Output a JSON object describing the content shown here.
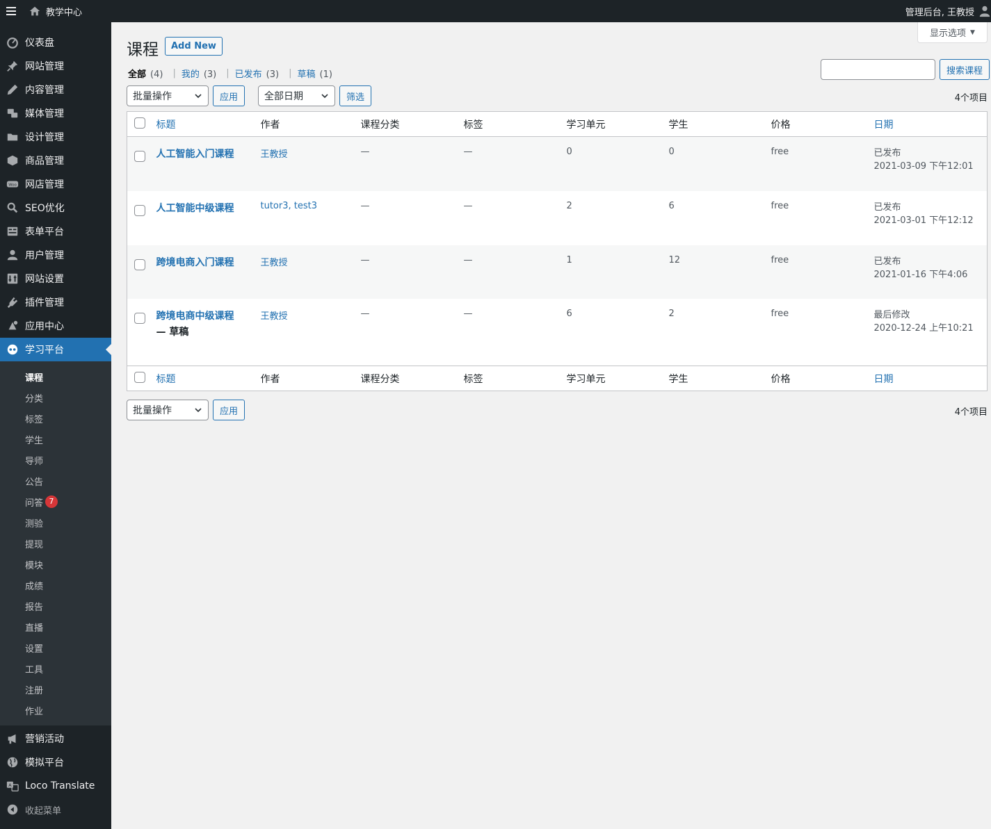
{
  "adminbar": {
    "site_name": "教学中心",
    "account_text": "管理后台, 王教授"
  },
  "sidebar": {
    "items": [
      {
        "label": "仪表盘",
        "icon": "dashboard-icon"
      },
      {
        "label": "网站管理",
        "icon": "pin-icon"
      },
      {
        "label": "内容管理",
        "icon": "pencil-icon"
      },
      {
        "label": "媒体管理",
        "icon": "media-icon"
      },
      {
        "label": "设计管理",
        "icon": "folder-icon"
      },
      {
        "label": "商品管理",
        "icon": "box-icon"
      },
      {
        "label": "网店管理",
        "icon": "woo-icon"
      },
      {
        "label": "SEO优化",
        "icon": "search-icon"
      },
      {
        "label": "表单平台",
        "icon": "form-icon"
      },
      {
        "label": "用户管理",
        "icon": "user-icon"
      },
      {
        "label": "网站设置",
        "icon": "settings-icon"
      },
      {
        "label": "插件管理",
        "icon": "plugin-icon"
      },
      {
        "label": "应用中心",
        "icon": "apps-icon"
      },
      {
        "label": "学习平台",
        "icon": "tutor-icon"
      }
    ],
    "submenu": [
      {
        "label": "课程"
      },
      {
        "label": "分类"
      },
      {
        "label": "标签"
      },
      {
        "label": "学生"
      },
      {
        "label": "导师"
      },
      {
        "label": "公告"
      },
      {
        "label": "问答",
        "badge": "7"
      },
      {
        "label": "测验"
      },
      {
        "label": "提现"
      },
      {
        "label": "模块"
      },
      {
        "label": "成绩"
      },
      {
        "label": "报告"
      },
      {
        "label": "直播"
      },
      {
        "label": "设置"
      },
      {
        "label": "工具"
      },
      {
        "label": "注册"
      },
      {
        "label": "作业"
      }
    ],
    "after_items": [
      {
        "label": "营销活动",
        "icon": "megaphone-icon"
      },
      {
        "label": "模拟平台",
        "icon": "globe-icon"
      },
      {
        "label": "Loco Translate",
        "icon": "translate-icon"
      },
      {
        "label": "收起菜单",
        "icon": "collapse-icon"
      }
    ]
  },
  "page": {
    "screen_options": "显示选项",
    "title": "课程",
    "add_new": "Add New",
    "views": [
      {
        "label": "全部",
        "count": "(4)"
      },
      {
        "label": "我的",
        "count": "(3)"
      },
      {
        "label": "已发布",
        "count": "(3)"
      },
      {
        "label": "草稿",
        "count": "(1)"
      }
    ],
    "search_button": "搜索课程",
    "search_value": "",
    "bulk_action": "批量操作",
    "apply": "应用",
    "date_filter": "全部日期",
    "filter": "筛选",
    "items_count": "4个项目"
  },
  "table": {
    "columns": [
      "标题",
      "作者",
      "课程分类",
      "标签",
      "学习单元",
      "学生",
      "价格",
      "日期"
    ],
    "rows": [
      {
        "title": "人工智能入门课程",
        "draft": "",
        "author": "王教授",
        "category": "—",
        "tags": "—",
        "lessons": "0",
        "students": "0",
        "price": "free",
        "status": "已发布",
        "date": "2021-03-09 下午12:01"
      },
      {
        "title": "人工智能中级课程",
        "draft": "",
        "author": "tutor3, test3",
        "category": "—",
        "tags": "—",
        "lessons": "2",
        "students": "6",
        "price": "free",
        "status": "已发布",
        "date": "2021-03-01 下午12:12"
      },
      {
        "title": "跨境电商入门课程",
        "draft": "",
        "author": "王教授",
        "category": "—",
        "tags": "—",
        "lessons": "1",
        "students": "12",
        "price": "free",
        "status": "已发布",
        "date": "2021-01-16 下午4:06"
      },
      {
        "title": "跨境电商中级课程",
        "draft": "— 草稿",
        "author": "王教授",
        "category": "—",
        "tags": "—",
        "lessons": "6",
        "students": "2",
        "price": "free",
        "status": "最后修改",
        "date": "2020-12-24 上午10:21"
      }
    ]
  }
}
